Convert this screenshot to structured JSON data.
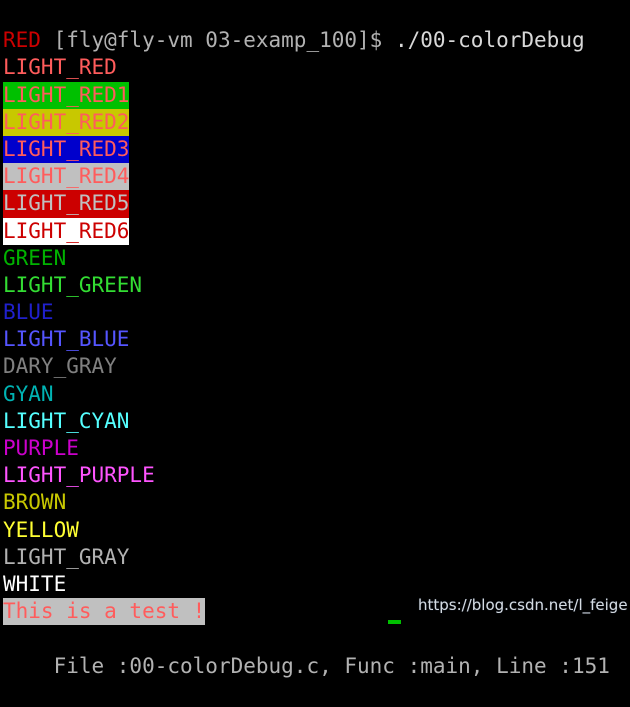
{
  "terminal": {
    "background": "#000000",
    "watermark": "https://blog.csdn.net/l_feige",
    "prompt_line": {
      "prompt": "[fly@fly-vm 03-examp_100]$ ",
      "command": "./00-colorDebug",
      "prompt_color": "#b2b2b2",
      "command_color": "#d8d8d8"
    },
    "lines": [
      {
        "text": "RED",
        "fg": "#cc0000",
        "bg": "transparent"
      },
      {
        "text": "LIGHT_RED",
        "fg": "#ff5c5c",
        "bg": "transparent"
      },
      {
        "text": "LIGHT_RED1",
        "fg": "#ff5c5c",
        "bg": "#00c000"
      },
      {
        "text": "LIGHT_RED2",
        "fg": "#ff5c5c",
        "bg": "#c8c800"
      },
      {
        "text": "LIGHT_RED3",
        "fg": "#ff5c5c",
        "bg": "#0000cc"
      },
      {
        "text": "LIGHT_RED4",
        "fg": "#ff5c5c",
        "bg": "#c0c0c0"
      },
      {
        "text": "LIGHT_RED5",
        "fg": "#c0c0c0",
        "bg": "#cc0000"
      },
      {
        "text": "LIGHT_RED6",
        "fg": "#cc0000",
        "bg": "#ffffff"
      },
      {
        "text": "GREEN",
        "fg": "#00b300",
        "bg": "transparent"
      },
      {
        "text": "LIGHT_GREEN",
        "fg": "#33dd33",
        "bg": "transparent"
      },
      {
        "text": "BLUE",
        "fg": "#2020cc",
        "bg": "transparent"
      },
      {
        "text": "LIGHT_BLUE",
        "fg": "#5555ff",
        "bg": "transparent"
      },
      {
        "text": "DARY_GRAY",
        "fg": "#808080",
        "bg": "transparent"
      },
      {
        "text": "GYAN",
        "fg": "#00b3b3",
        "bg": "transparent"
      },
      {
        "text": "LIGHT_CYAN",
        "fg": "#55ffff",
        "bg": "transparent"
      },
      {
        "text": "PURPLE",
        "fg": "#cc00cc",
        "bg": "transparent"
      },
      {
        "text": "LIGHT_PURPLE",
        "fg": "#ff55ff",
        "bg": "transparent"
      },
      {
        "text": "BROWN",
        "fg": "#c8c800",
        "bg": "transparent"
      },
      {
        "text": "YELLOW",
        "fg": "#ffff33",
        "bg": "transparent"
      },
      {
        "text": "LIGHT_GRAY",
        "fg": "#b2b2b2",
        "bg": "transparent"
      },
      {
        "text": "WHITE",
        "fg": "#ffffff",
        "bg": "transparent"
      },
      {
        "text": "This is a test !",
        "fg": "#ff5c5c",
        "bg": "#c0c0c0"
      }
    ],
    "status_line": {
      "text": "File :00-colorDebug.c, Func :main, Line :151",
      "fg": "#b2b2b2"
    }
  }
}
